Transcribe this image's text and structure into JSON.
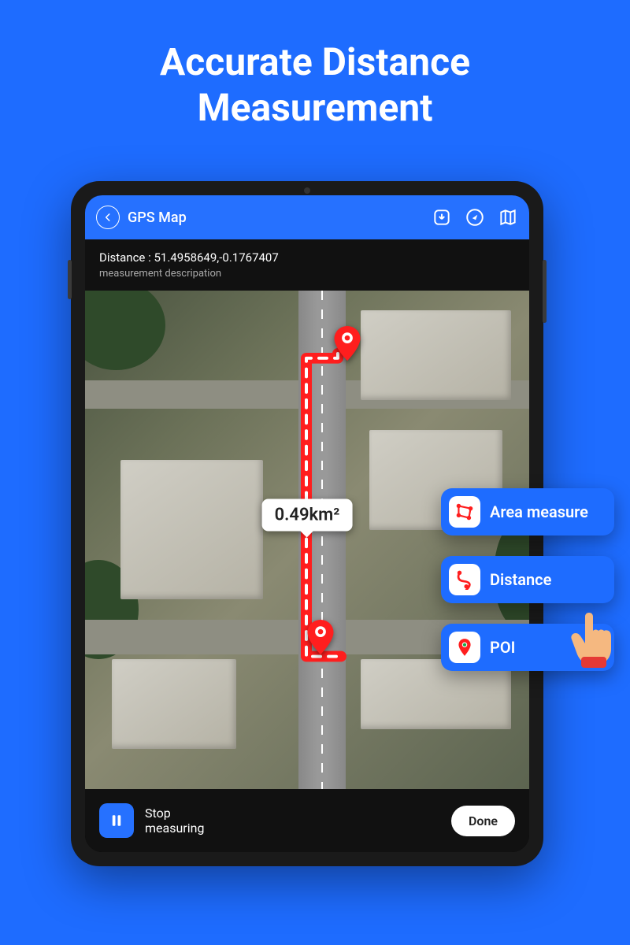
{
  "promo": {
    "title_l1": "Accurate Distance",
    "title_l2": "Measurement"
  },
  "appbar": {
    "title": "GPS Map"
  },
  "info": {
    "distance": "Distance : 51.4958649,-0.1767407",
    "desc": "measurement descripation"
  },
  "measurement": {
    "label": "0.49km²"
  },
  "bottombar": {
    "stop_l1": "Stop",
    "stop_l2": "measuring",
    "done": "Done"
  },
  "fabs": [
    {
      "label": "Area measure"
    },
    {
      "label": "Distance"
    },
    {
      "label": "POI"
    }
  ],
  "colors": {
    "accent": "#2671ff",
    "path": "#ff1e1e"
  }
}
